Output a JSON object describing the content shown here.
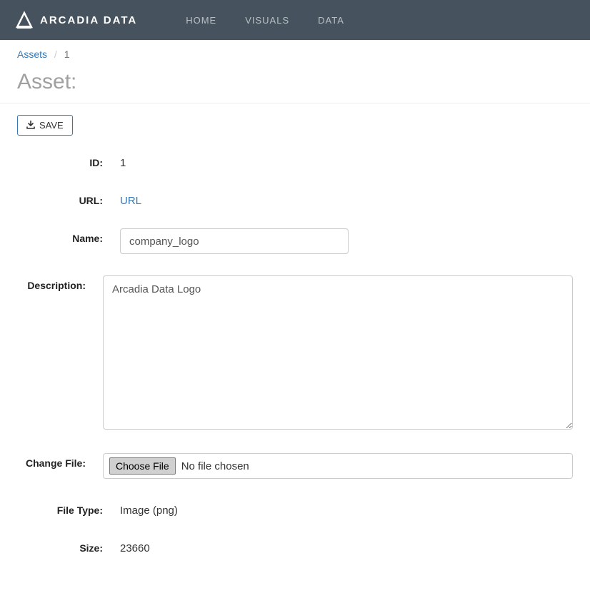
{
  "brand": {
    "text": "ARCADIA DATA"
  },
  "nav": {
    "home": "HOME",
    "visuals": "VISUALS",
    "data": "DATA"
  },
  "breadcrumb": {
    "root": "Assets",
    "sep": "/",
    "current": "1"
  },
  "page": {
    "title": "Asset:"
  },
  "actions": {
    "save": "SAVE"
  },
  "form": {
    "labels": {
      "id": "ID:",
      "url": "URL:",
      "name": "Name:",
      "description": "Description:",
      "change_file": "Change File:",
      "file_type": "File Type:",
      "size": "Size:"
    },
    "values": {
      "id": "1",
      "url_link": "URL",
      "name": "company_logo",
      "description": "Arcadia Data Logo",
      "file_button": "Choose File",
      "file_status": "No file chosen",
      "file_type": "Image (png)",
      "size": "23660"
    }
  }
}
